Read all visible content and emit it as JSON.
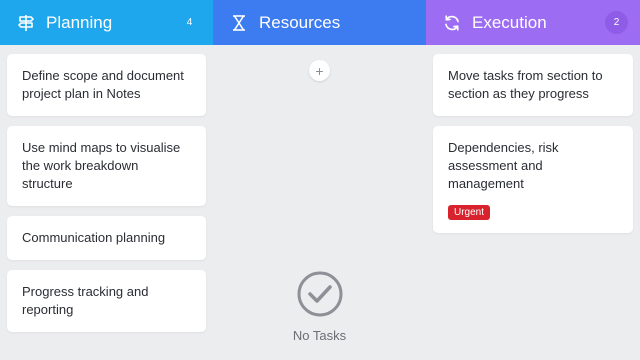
{
  "colors": {
    "planning": "#1ea7ec",
    "resources": "#3d7bf0",
    "execution": "#9c6cf3",
    "urgent": "#d8232f"
  },
  "columns": {
    "planning": {
      "title": "Planning",
      "count": "4",
      "icon": "signpost-icon",
      "cards": [
        {
          "text": "Define scope and document project plan in Notes"
        },
        {
          "text": "Use mind maps to visualise the work breakdown structure"
        },
        {
          "text": "Communication planning"
        },
        {
          "text": "Progress tracking and reporting"
        }
      ]
    },
    "resources": {
      "title": "Resources",
      "icon": "hourglass-icon",
      "add_label": "+",
      "empty_text": "No Tasks"
    },
    "execution": {
      "title": "Execution",
      "count": "2",
      "icon": "refresh-icon",
      "cards": [
        {
          "text": "Move tasks from section to section as they progress"
        },
        {
          "text": "Dependencies, risk assessment and management",
          "tag": "Urgent"
        }
      ]
    }
  }
}
